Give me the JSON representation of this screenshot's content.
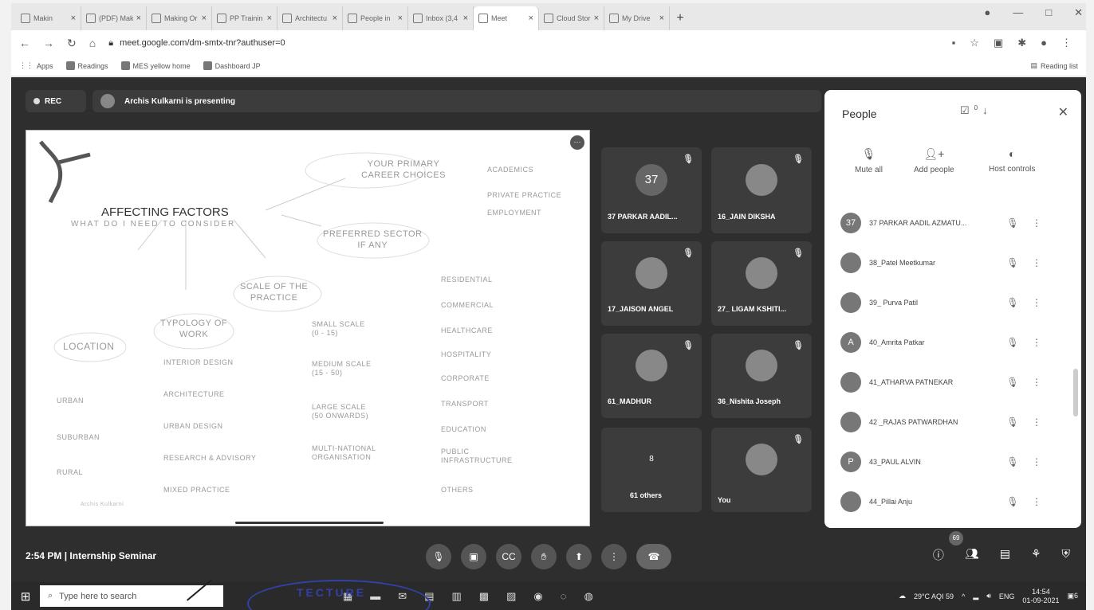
{
  "browser": {
    "tabs": [
      {
        "label": "Makin"
      },
      {
        "label": "(PDF) Mak"
      },
      {
        "label": "Making Or"
      },
      {
        "label": "PP Trainin"
      },
      {
        "label": "Architectu"
      },
      {
        "label": "People in"
      },
      {
        "label": "Inbox (3,4"
      },
      {
        "label": "Meet",
        "active": true
      },
      {
        "label": "Cloud Stor"
      },
      {
        "label": "My Drive"
      }
    ],
    "new_tab": "+",
    "url": "meet.google.com/dm-smtx-tnr?authuser=0",
    "bookmarks": [
      "Apps",
      "Readings",
      "MES yellow home",
      "Dashboard JP"
    ],
    "reading_list": "Reading list"
  },
  "meet": {
    "rec_label": "REC",
    "presenting_text": "Archis Kulkarni is presenting",
    "slide": {
      "title": "AFFECTING FACTORS",
      "subtitle": "WHAT DO I NEED TO CONSIDER",
      "career": "YOUR PRIMARY\nCAREER CHOICES",
      "career_opts": [
        "ACADEMICS",
        "PRIVATE PRACTICE",
        "EMPLOYMENT"
      ],
      "sector": "PREFERRED SECTOR\nIF ANY",
      "scale": "SCALE OF THE\nPRACTICE",
      "typology": "TYPOLOGY OF\nWORK",
      "location": "LOCATION",
      "locations": [
        "URBAN",
        "SUBURBAN",
        "RURAL"
      ],
      "typology_opts": [
        "INTERIOR DESIGN",
        "ARCHITECTURE",
        "URBAN DESIGN",
        "RESEARCH & ADVISORY",
        "MIXED PRACTICE"
      ],
      "scale_opts": [
        "SMALL SCALE\n(0 - 15)",
        "MEDIUM SCALE\n(15 - 50)",
        "LARGE SCALE\n(50 ONWARDS)",
        "MULTI-NATIONAL\nORGANISATION"
      ],
      "sector_opts": [
        "RESIDENTIAL",
        "COMMERCIAL",
        "HEALTHCARE",
        "HOSPITALITY",
        "CORPORATE",
        "TRANSPORT",
        "EDUCATION",
        "PUBLIC\nINFRASTRUCTURE",
        "OTHERS"
      ],
      "signature": "Archis Kulkarni"
    },
    "tiles": [
      {
        "name": "37 PARKAR AADIL...",
        "avatar": "37"
      },
      {
        "name": "16_JAIN DIKSHA",
        "avatar": ""
      },
      {
        "name": "17_JAISON ANGEL",
        "avatar": ""
      },
      {
        "name": "27_ LIGAM KSHITI...",
        "avatar": ""
      },
      {
        "name": "61_MADHUR",
        "avatar": ""
      },
      {
        "name": "36_Nishita Joseph",
        "avatar": ""
      },
      {
        "name": "61 others",
        "avatar": "8"
      },
      {
        "name": "You",
        "avatar": ""
      }
    ],
    "people": {
      "title": "People",
      "count": "0",
      "mute_all": "Mute all",
      "add_people": "Add people",
      "host_controls": "Host controls",
      "list": [
        {
          "name": "37 PARKAR AADIL AZMATU...",
          "avatar": "37"
        },
        {
          "name": "38_Patel Meetkumar",
          "avatar": ""
        },
        {
          "name": "39_ Purva Patil",
          "avatar": ""
        },
        {
          "name": "40_Amrita Patkar",
          "avatar": "A"
        },
        {
          "name": "41_ATHARVA PATNEKAR",
          "avatar": ""
        },
        {
          "name": "42 _RAJAS PATWARDHAN",
          "avatar": ""
        },
        {
          "name": "43_PAUL ALVIN",
          "avatar": "P"
        },
        {
          "name": "44_Pillai Anju",
          "avatar": ""
        }
      ]
    },
    "time": "2:54 PM",
    "separator": "|",
    "meeting_name": "Internship Seminar",
    "participants_badge": "69"
  },
  "taskbar": {
    "search_placeholder": "Type here to search",
    "stamp_text": "TECTURE",
    "weather": "29°C AQI 59",
    "lang": "ENG",
    "clock_time": "14:54",
    "clock_date": "01-09-2021",
    "notif_count": "6"
  }
}
